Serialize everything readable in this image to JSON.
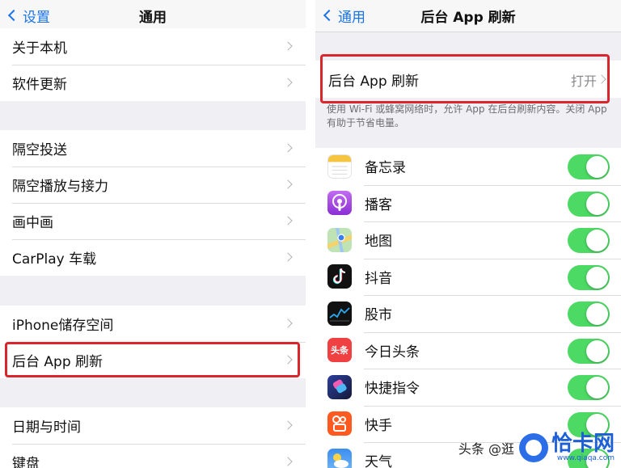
{
  "left": {
    "nav": {
      "back_label": "设置",
      "title": "通用"
    },
    "groups": [
      [
        "关于本机",
        "软件更新"
      ],
      [
        "隔空投送",
        "隔空播放与接力",
        "画中画",
        "CarPlay 车载"
      ],
      [
        "iPhone储存空间",
        "后台 App 刷新"
      ],
      [
        "日期与时间",
        "键盘"
      ]
    ]
  },
  "right": {
    "nav": {
      "back_label": "通用",
      "title": "后台 App 刷新"
    },
    "refresh": {
      "label": "后台 App 刷新",
      "value": "打开"
    },
    "footnote": "使用 Wi-Fi 或蜂窝网络时，允许 App 在后台刷新内容。关闭 App 有助于节省电量。",
    "apps": [
      {
        "name": "备忘录",
        "icon": "notes-icon",
        "enabled": true
      },
      {
        "name": "播客",
        "icon": "podcasts-icon",
        "enabled": true
      },
      {
        "name": "地图",
        "icon": "maps-icon",
        "enabled": true
      },
      {
        "name": "抖音",
        "icon": "douyin-icon",
        "enabled": true
      },
      {
        "name": "股市",
        "icon": "stocks-icon",
        "enabled": true
      },
      {
        "name": "今日头条",
        "icon": "toutiao-icon",
        "enabled": true,
        "icon_text": "头条"
      },
      {
        "name": "快捷指令",
        "icon": "shortcuts-icon",
        "enabled": true
      },
      {
        "name": "快手",
        "icon": "kuaishou-icon",
        "enabled": true
      },
      {
        "name": "天气",
        "icon": "weather-icon",
        "enabled": true
      }
    ]
  },
  "watermark": {
    "prefix": "头条 @逛",
    "brand": "恰卡网",
    "domain": "www.qiaqa.com"
  },
  "colors": {
    "accent": "#1a74e8",
    "toggle_on": "#4cd964",
    "highlight": "#d8262c"
  }
}
